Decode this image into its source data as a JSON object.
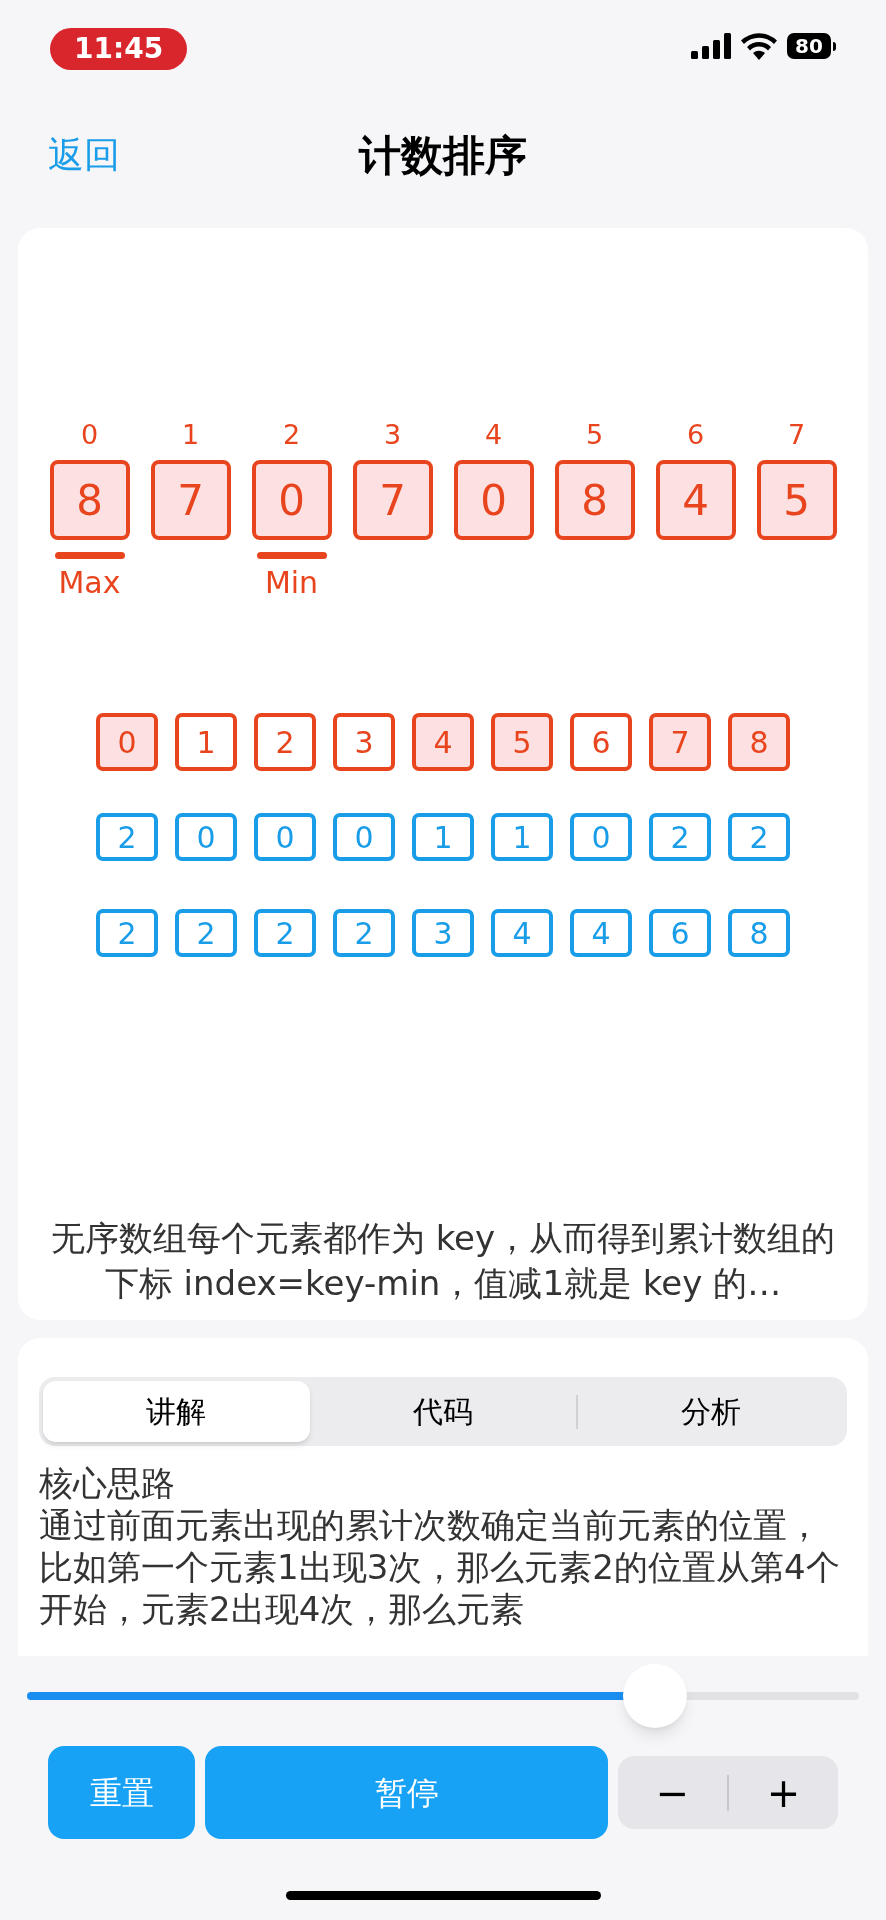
{
  "status_bar": {
    "time": "11:45",
    "battery": "80"
  },
  "nav": {
    "back": "返回",
    "title": "计数排序"
  },
  "array": [
    {
      "index": "0",
      "value": "8",
      "marker": "Max"
    },
    {
      "index": "1",
      "value": "7"
    },
    {
      "index": "2",
      "value": "0",
      "marker": "Min"
    },
    {
      "index": "3",
      "value": "7"
    },
    {
      "index": "4",
      "value": "0"
    },
    {
      "index": "5",
      "value": "8"
    },
    {
      "index": "6",
      "value": "4"
    },
    {
      "index": "7",
      "value": "5"
    }
  ],
  "count_keys": [
    {
      "value": "0",
      "highlighted": true
    },
    {
      "value": "1",
      "highlighted": false
    },
    {
      "value": "2",
      "highlighted": false
    },
    {
      "value": "3",
      "highlighted": false
    },
    {
      "value": "4",
      "highlighted": true
    },
    {
      "value": "5",
      "highlighted": true
    },
    {
      "value": "6",
      "highlighted": false
    },
    {
      "value": "7",
      "highlighted": true
    },
    {
      "value": "8",
      "highlighted": true
    }
  ],
  "counts": [
    "2",
    "0",
    "0",
    "0",
    "1",
    "1",
    "0",
    "2",
    "2"
  ],
  "cumulative": [
    "2",
    "2",
    "2",
    "2",
    "3",
    "4",
    "4",
    "6",
    "8"
  ],
  "caption": "无序数组每个元素都作为 key，从而得到累计数组的下标 index=key-min，值减1就是 key 的…",
  "tabs": [
    {
      "label": "讲解",
      "selected": true
    },
    {
      "label": "代码",
      "selected": false
    },
    {
      "label": "分析",
      "selected": false
    }
  ],
  "explanation": {
    "heading": "核心思路",
    "body": "通过前面元素出现的累计次数确定当前元素的位置，比如第一个元素1出现3次，那么元素2的位置从第4个开始，元素2出现4次，那么元素"
  },
  "slider": {
    "level": 0.755
  },
  "buttons": {
    "reset": "重置",
    "pause": "暂停"
  },
  "stepper": {
    "minus": "−",
    "plus": "+"
  }
}
